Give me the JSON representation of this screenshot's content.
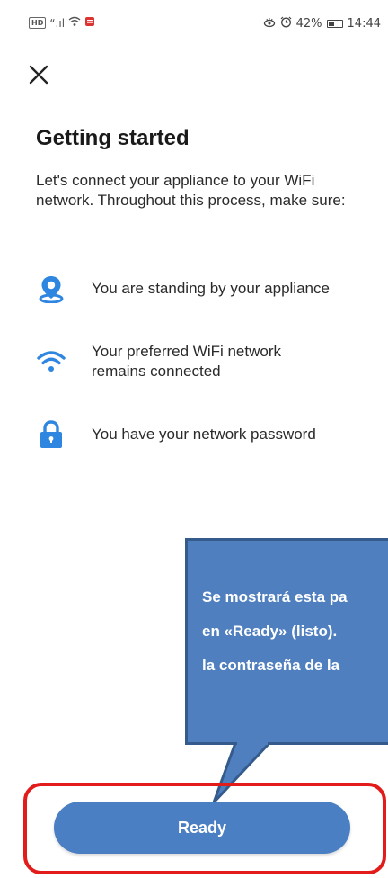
{
  "status_bar": {
    "left_text": "“.ıl",
    "battery_percent": "42%",
    "battery_level": 0.42,
    "time": "14:44"
  },
  "header": {
    "close_icon": "close-icon"
  },
  "main": {
    "title": "Getting started",
    "intro": "Let's connect your appliance to your WiFi network. Throughout this process, make sure:",
    "requirements": [
      {
        "icon": "location-pin-icon",
        "text": "You are standing by your appliance"
      },
      {
        "icon": "wifi-icon",
        "text": "Your preferred WiFi network remains connected"
      },
      {
        "icon": "lock-icon",
        "text": "You have your network password"
      }
    ]
  },
  "annotation": {
    "lines": [
      "Se mostrará esta pa",
      "en «Ready» (listo).",
      "la contraseña de la"
    ]
  },
  "footer": {
    "ready_label": "Ready"
  },
  "colors": {
    "accent": "#4a7fc4",
    "callout": "#4f7fbf",
    "highlight": "#e21b1b",
    "icon_blue": "#2f86e0"
  }
}
